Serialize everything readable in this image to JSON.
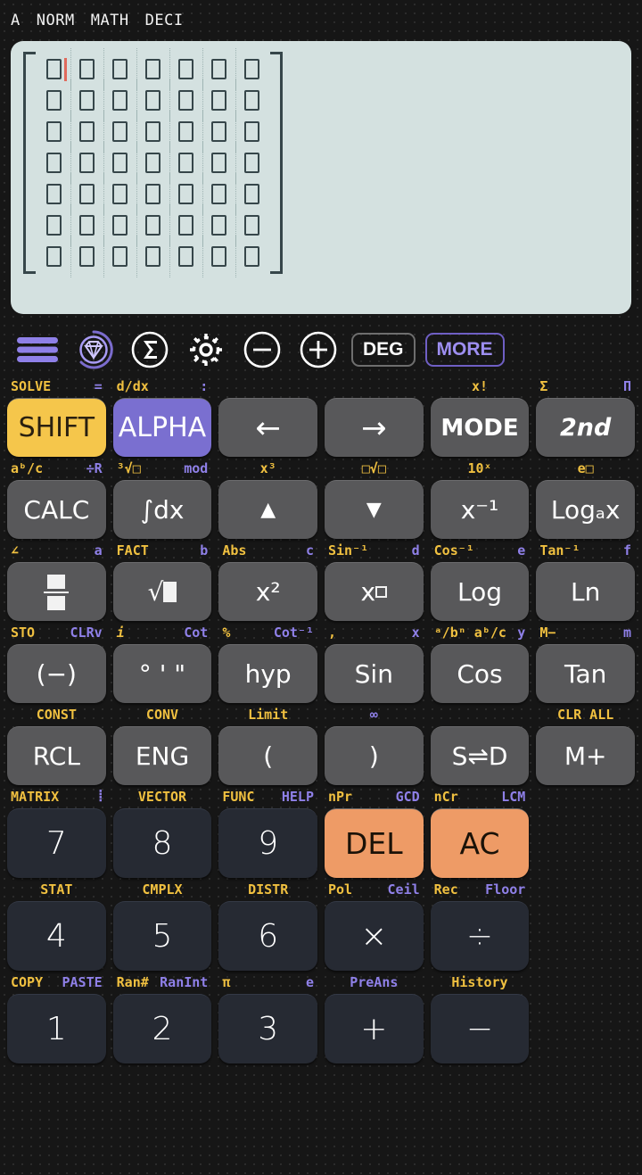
{
  "status_bar": {
    "items": [
      "A",
      "NORM",
      "MATH",
      "DECI"
    ]
  },
  "display": {
    "expression_type": "matrix",
    "rows": 7,
    "cols": 7,
    "cell_placeholder": "",
    "cursor_row": 0,
    "cursor_col": 0,
    "bg_color": "#d4e1e0",
    "ink_color": "#36464a",
    "cursor_color": "#e06a5c"
  },
  "toolbar": {
    "items": [
      {
        "name": "menu-icon",
        "label": "menu",
        "color": "#8f80e8"
      },
      {
        "name": "gem-icon",
        "label": "premium",
        "color": "#8f80e8"
      },
      {
        "name": "sigma-icon",
        "label": "sum",
        "color": "#ffffff"
      },
      {
        "name": "gear-icon",
        "label": "settings",
        "color": "#ffffff"
      },
      {
        "name": "minus-circle-icon",
        "label": "zoom-out",
        "color": "#ffffff"
      },
      {
        "name": "plus-circle-icon",
        "label": "zoom-in",
        "color": "#ffffff"
      }
    ],
    "angle_mode": "DEG",
    "more_label": "MORE"
  },
  "keypad": {
    "rows": [
      {
        "labels": [
          {
            "y": "SOLVE",
            "p": "="
          },
          {
            "y": "d/dx",
            "p": ":"
          },
          {
            "y": "",
            "p": ""
          },
          {
            "y": "",
            "p": ""
          },
          {
            "y": "x!",
            "p": ""
          },
          {
            "y": "Σ",
            "p": "Π"
          }
        ],
        "keys": [
          {
            "label": "SHIFT",
            "style": "shift"
          },
          {
            "label": "ALPHA",
            "style": "alpha"
          },
          {
            "label": "←",
            "style": "plain"
          },
          {
            "label": "→",
            "style": "plain"
          },
          {
            "label": "MODE",
            "style": "bold"
          },
          {
            "label": "2nd",
            "style": "italic"
          }
        ]
      },
      {
        "labels": [
          {
            "y": "aᵇ/c",
            "p": "÷R"
          },
          {
            "y": "³√□",
            "p": "mod"
          },
          {
            "y": "x³",
            "p": ""
          },
          {
            "y": "□√□",
            "p": ""
          },
          {
            "y": "10ˣ",
            "p": ""
          },
          {
            "y": "e□",
            "p": ""
          }
        ],
        "keys": [
          {
            "label": "CALC",
            "style": "plain"
          },
          {
            "label": "∫dx",
            "style": "plain"
          },
          {
            "label": "▲",
            "style": "plain"
          },
          {
            "label": "▼",
            "style": "plain"
          },
          {
            "label": "x⁻¹",
            "style": "plain"
          },
          {
            "label": "Logₐx",
            "style": "plain"
          }
        ]
      },
      {
        "labels": [
          {
            "y": "∠",
            "p": "a"
          },
          {
            "y": "FACT",
            "p": "b"
          },
          {
            "y": "Abs",
            "p": "c"
          },
          {
            "y": "Sin⁻¹",
            "p": "d"
          },
          {
            "y": "Cos⁻¹",
            "p": "e"
          },
          {
            "y": "Tan⁻¹",
            "p": "f"
          }
        ],
        "keys": [
          {
            "label": "fraction",
            "style": "plain"
          },
          {
            "label": "√■",
            "style": "plain"
          },
          {
            "label": "x²",
            "style": "plain"
          },
          {
            "label": "x□",
            "style": "plain"
          },
          {
            "label": "Log",
            "style": "plain"
          },
          {
            "label": "Ln",
            "style": "plain"
          }
        ]
      },
      {
        "labels": [
          {
            "y": "STO",
            "p": "CLRv"
          },
          {
            "y": "i",
            "p": "Cot"
          },
          {
            "y": "%",
            "p": "Cot⁻¹"
          },
          {
            "y": ",",
            "p": "x"
          },
          {
            "y": "ᵃ/bⁿ aᵇ/c",
            "p": "y"
          },
          {
            "y": "M−",
            "p": "m"
          }
        ],
        "keys": [
          {
            "label": "(−)",
            "style": "plain"
          },
          {
            "label": "° ' \"",
            "style": "plain"
          },
          {
            "label": "hyp",
            "style": "plain"
          },
          {
            "label": "Sin",
            "style": "plain"
          },
          {
            "label": "Cos",
            "style": "plain"
          },
          {
            "label": "Tan",
            "style": "plain"
          }
        ]
      },
      {
        "labels": [
          {
            "y": "CONST",
            "p": ""
          },
          {
            "y": "CONV",
            "p": ""
          },
          {
            "y": "Limit",
            "p": ""
          },
          {
            "y": "",
            "p": "∞"
          },
          {
            "y": "",
            "p": ""
          },
          {
            "y": "CLR ALL",
            "p": ""
          }
        ],
        "keys": [
          {
            "label": "RCL",
            "style": "plain"
          },
          {
            "label": "ENG",
            "style": "plain"
          },
          {
            "label": "(",
            "style": "plain"
          },
          {
            "label": ")",
            "style": "plain"
          },
          {
            "label": "S⇌D",
            "style": "plain"
          },
          {
            "label": "M+",
            "style": "plain"
          }
        ]
      },
      {
        "labels": [
          {
            "y": "MATRIX",
            "p": "⦙"
          },
          {
            "y": "VECTOR",
            "p": ""
          },
          {
            "y": "FUNC",
            "p": "HELP"
          },
          {
            "y": "nPr",
            "p": "GCD"
          },
          {
            "y": "nCr",
            "p": "LCM"
          },
          {
            "y": "",
            "p": ""
          }
        ],
        "keys": [
          {
            "label": "7",
            "style": "dark"
          },
          {
            "label": "8",
            "style": "dark"
          },
          {
            "label": "9",
            "style": "dark"
          },
          {
            "label": "DEL",
            "style": "orange"
          },
          {
            "label": "AC",
            "style": "orange"
          },
          {
            "label": "",
            "style": "none"
          }
        ]
      },
      {
        "labels": [
          {
            "y": "STAT",
            "p": ""
          },
          {
            "y": "CMPLX",
            "p": ""
          },
          {
            "y": "DISTR",
            "p": ""
          },
          {
            "y": "Pol",
            "p": "Ceil"
          },
          {
            "y": "Rec",
            "p": "Floor"
          },
          {
            "y": "",
            "p": ""
          }
        ],
        "keys": [
          {
            "label": "4",
            "style": "dark"
          },
          {
            "label": "5",
            "style": "dark"
          },
          {
            "label": "6",
            "style": "dark"
          },
          {
            "label": "×",
            "style": "dark"
          },
          {
            "label": "÷",
            "style": "dark"
          },
          {
            "label": "",
            "style": "none"
          }
        ]
      },
      {
        "labels": [
          {
            "y": "COPY",
            "p": "PASTE"
          },
          {
            "y": "Ran#",
            "p": "RanInt"
          },
          {
            "y": "π",
            "p": "e"
          },
          {
            "y": "",
            "p": "PreAns"
          },
          {
            "y": "History",
            "p": ""
          },
          {
            "y": "",
            "p": ""
          }
        ],
        "keys": [
          {
            "label": "1",
            "style": "dark"
          },
          {
            "label": "2",
            "style": "dark"
          },
          {
            "label": "3",
            "style": "dark"
          },
          {
            "label": "+",
            "style": "dark"
          },
          {
            "label": "−",
            "style": "dark"
          },
          {
            "label": "",
            "style": "none"
          }
        ]
      }
    ]
  },
  "colors": {
    "shift_key": "#f5c64b",
    "alpha_key": "#7a6fd0",
    "function_key": "#58585a",
    "number_key": "#262a33",
    "action_key": "#ee9b66",
    "shift_label": "#f0c040",
    "alpha_label": "#8f80e8"
  }
}
